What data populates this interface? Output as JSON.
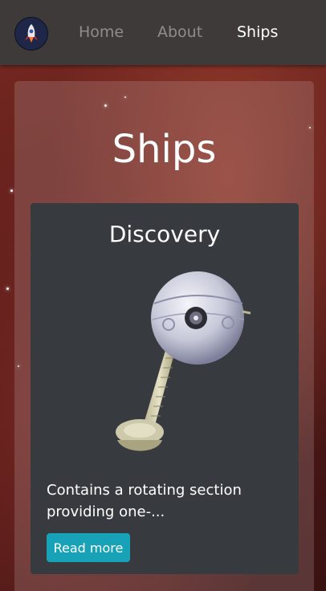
{
  "nav": {
    "links": [
      {
        "label": "Home"
      },
      {
        "label": "About"
      },
      {
        "label": "Ships"
      }
    ],
    "active": "Ships"
  },
  "page": {
    "title": "Ships"
  },
  "card": {
    "title": "Discovery",
    "description": "Contains a rotating section providing one-...",
    "button_label": "Read more"
  },
  "colors": {
    "navbar": "#3e3a3a",
    "card": "#373a3f",
    "button": "#17a2b8"
  }
}
